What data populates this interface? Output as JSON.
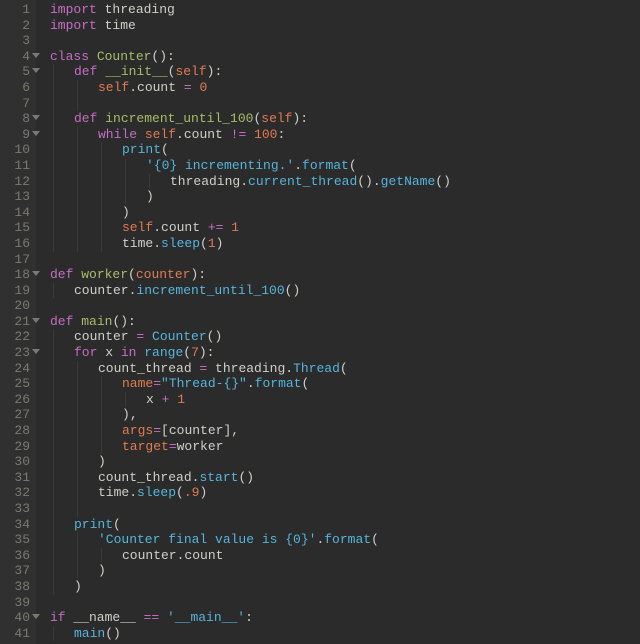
{
  "code": {
    "lines": [
      {
        "n": 1,
        "fold": false,
        "tokens": [
          [
            "kw",
            "import"
          ],
          [
            "name",
            " threading"
          ]
        ]
      },
      {
        "n": 2,
        "fold": false,
        "tokens": [
          [
            "kw",
            "import"
          ],
          [
            "name",
            " time"
          ]
        ]
      },
      {
        "n": 3,
        "fold": false,
        "tokens": []
      },
      {
        "n": 4,
        "fold": true,
        "tokens": [
          [
            "kw",
            "class "
          ],
          [
            "fn",
            "Counter"
          ],
          [
            "paren",
            "():"
          ]
        ]
      },
      {
        "n": 5,
        "fold": true,
        "indent": 1,
        "tokens": [
          [
            "kw",
            "def "
          ],
          [
            "fn",
            "__init__"
          ],
          [
            "paren",
            "("
          ],
          [
            "arg",
            "self"
          ],
          [
            "paren",
            "):"
          ]
        ]
      },
      {
        "n": 6,
        "fold": false,
        "indent": 2,
        "tokens": [
          [
            "arg",
            "self"
          ],
          [
            "name",
            "."
          ],
          [
            "name",
            "count "
          ],
          [
            "op",
            "="
          ],
          [
            "name",
            " "
          ],
          [
            "num",
            "0"
          ]
        ]
      },
      {
        "n": 7,
        "fold": false,
        "indent": 2,
        "tokens": []
      },
      {
        "n": 8,
        "fold": true,
        "indent": 1,
        "tokens": [
          [
            "kw",
            "def "
          ],
          [
            "fn",
            "increment_until_100"
          ],
          [
            "paren",
            "("
          ],
          [
            "arg",
            "self"
          ],
          [
            "paren",
            "):"
          ]
        ]
      },
      {
        "n": 9,
        "fold": true,
        "indent": 2,
        "tokens": [
          [
            "kw",
            "while "
          ],
          [
            "arg",
            "self"
          ],
          [
            "name",
            "."
          ],
          [
            "name",
            "count "
          ],
          [
            "op",
            "!="
          ],
          [
            "name",
            " "
          ],
          [
            "num",
            "100"
          ],
          [
            "paren",
            ":"
          ]
        ]
      },
      {
        "n": 10,
        "fold": false,
        "indent": 3,
        "tokens": [
          [
            "bcall",
            "print"
          ],
          [
            "paren",
            "("
          ]
        ]
      },
      {
        "n": 11,
        "fold": false,
        "indent": 4,
        "tokens": [
          [
            "str",
            "'{0} incrementing.'"
          ],
          [
            "name",
            "."
          ],
          [
            "bcall",
            "format"
          ],
          [
            "paren",
            "("
          ]
        ]
      },
      {
        "n": 12,
        "fold": false,
        "indent": 5,
        "tokens": [
          [
            "name",
            "threading"
          ],
          [
            "name",
            "."
          ],
          [
            "bcall",
            "current_thread"
          ],
          [
            "paren",
            "()"
          ],
          [
            "name",
            "."
          ],
          [
            "bcall",
            "getName"
          ],
          [
            "paren",
            "()"
          ]
        ]
      },
      {
        "n": 13,
        "fold": false,
        "indent": 4,
        "tokens": [
          [
            "paren",
            ")"
          ]
        ]
      },
      {
        "n": 14,
        "fold": false,
        "indent": 3,
        "tokens": [
          [
            "paren",
            ")"
          ]
        ]
      },
      {
        "n": 15,
        "fold": false,
        "indent": 3,
        "tokens": [
          [
            "arg",
            "self"
          ],
          [
            "name",
            "."
          ],
          [
            "name",
            "count "
          ],
          [
            "op",
            "+="
          ],
          [
            "name",
            " "
          ],
          [
            "num",
            "1"
          ]
        ]
      },
      {
        "n": 16,
        "fold": false,
        "indent": 3,
        "tokens": [
          [
            "name",
            "time"
          ],
          [
            "name",
            "."
          ],
          [
            "bcall",
            "sleep"
          ],
          [
            "paren",
            "("
          ],
          [
            "num",
            "1"
          ],
          [
            "paren",
            ")"
          ]
        ]
      },
      {
        "n": 17,
        "fold": false,
        "tokens": []
      },
      {
        "n": 18,
        "fold": true,
        "tokens": [
          [
            "kw",
            "def "
          ],
          [
            "fn",
            "worker"
          ],
          [
            "paren",
            "("
          ],
          [
            "arg",
            "counter"
          ],
          [
            "paren",
            "):"
          ]
        ]
      },
      {
        "n": 19,
        "fold": false,
        "indent": 1,
        "tokens": [
          [
            "name",
            "counter"
          ],
          [
            "name",
            "."
          ],
          [
            "bcall",
            "increment_until_100"
          ],
          [
            "paren",
            "()"
          ]
        ]
      },
      {
        "n": 20,
        "fold": false,
        "tokens": []
      },
      {
        "n": 21,
        "fold": true,
        "tokens": [
          [
            "kw",
            "def "
          ],
          [
            "fn",
            "main"
          ],
          [
            "paren",
            "():"
          ]
        ]
      },
      {
        "n": 22,
        "fold": false,
        "indent": 1,
        "tokens": [
          [
            "name",
            "counter "
          ],
          [
            "op",
            "="
          ],
          [
            "name",
            " "
          ],
          [
            "bcall",
            "Counter"
          ],
          [
            "paren",
            "()"
          ]
        ]
      },
      {
        "n": 23,
        "fold": true,
        "indent": 1,
        "tokens": [
          [
            "kw",
            "for "
          ],
          [
            "name",
            "x "
          ],
          [
            "kw",
            "in "
          ],
          [
            "bcall",
            "range"
          ],
          [
            "paren",
            "("
          ],
          [
            "num",
            "7"
          ],
          [
            "paren",
            "):"
          ]
        ]
      },
      {
        "n": 24,
        "fold": false,
        "indent": 2,
        "tokens": [
          [
            "name",
            "count_thread "
          ],
          [
            "op",
            "="
          ],
          [
            "name",
            " threading"
          ],
          [
            "name",
            "."
          ],
          [
            "bcall",
            "Thread"
          ],
          [
            "paren",
            "("
          ]
        ]
      },
      {
        "n": 25,
        "fold": false,
        "indent": 3,
        "tokens": [
          [
            "arg",
            "name"
          ],
          [
            "op",
            "="
          ],
          [
            "str",
            "\"Thread-{}\""
          ],
          [
            "name",
            "."
          ],
          [
            "bcall",
            "format"
          ],
          [
            "paren",
            "("
          ]
        ]
      },
      {
        "n": 26,
        "fold": false,
        "indent": 4,
        "tokens": [
          [
            "name",
            "x "
          ],
          [
            "op",
            "+"
          ],
          [
            "name",
            " "
          ],
          [
            "num",
            "1"
          ]
        ]
      },
      {
        "n": 27,
        "fold": false,
        "indent": 3,
        "tokens": [
          [
            "paren",
            ")"
          ],
          [
            "name",
            ","
          ]
        ]
      },
      {
        "n": 28,
        "fold": false,
        "indent": 3,
        "tokens": [
          [
            "arg",
            "args"
          ],
          [
            "op",
            "="
          ],
          [
            "paren",
            "["
          ],
          [
            "name",
            "counter"
          ],
          [
            "paren",
            "]"
          ],
          [
            "name",
            ","
          ]
        ]
      },
      {
        "n": 29,
        "fold": false,
        "indent": 3,
        "tokens": [
          [
            "arg",
            "target"
          ],
          [
            "op",
            "="
          ],
          [
            "name",
            "worker"
          ]
        ]
      },
      {
        "n": 30,
        "fold": false,
        "indent": 2,
        "tokens": [
          [
            "paren",
            ")"
          ]
        ]
      },
      {
        "n": 31,
        "fold": false,
        "indent": 2,
        "tokens": [
          [
            "name",
            "count_thread"
          ],
          [
            "name",
            "."
          ],
          [
            "bcall",
            "start"
          ],
          [
            "paren",
            "()"
          ]
        ]
      },
      {
        "n": 32,
        "fold": false,
        "indent": 2,
        "tokens": [
          [
            "name",
            "time"
          ],
          [
            "name",
            "."
          ],
          [
            "bcall",
            "sleep"
          ],
          [
            "paren",
            "("
          ],
          [
            "num",
            ".9"
          ],
          [
            "paren",
            ")"
          ]
        ]
      },
      {
        "n": 33,
        "fold": false,
        "indent": 2,
        "tokens": []
      },
      {
        "n": 34,
        "fold": false,
        "indent": 1,
        "tokens": [
          [
            "bcall",
            "print"
          ],
          [
            "paren",
            "("
          ]
        ]
      },
      {
        "n": 35,
        "fold": false,
        "indent": 2,
        "tokens": [
          [
            "str",
            "'Counter final value is {0}'"
          ],
          [
            "name",
            "."
          ],
          [
            "bcall",
            "format"
          ],
          [
            "paren",
            "("
          ]
        ]
      },
      {
        "n": 36,
        "fold": false,
        "indent": 3,
        "tokens": [
          [
            "name",
            "counter"
          ],
          [
            "name",
            "."
          ],
          [
            "name",
            "count"
          ]
        ]
      },
      {
        "n": 37,
        "fold": false,
        "indent": 2,
        "tokens": [
          [
            "paren",
            ")"
          ]
        ]
      },
      {
        "n": 38,
        "fold": false,
        "indent": 1,
        "tokens": [
          [
            "paren",
            ")"
          ]
        ]
      },
      {
        "n": 39,
        "fold": false,
        "tokens": []
      },
      {
        "n": 40,
        "fold": true,
        "tokens": [
          [
            "kw",
            "if "
          ],
          [
            "name",
            "__name__ "
          ],
          [
            "op",
            "=="
          ],
          [
            "name",
            " "
          ],
          [
            "str",
            "'__main__'"
          ],
          [
            "paren",
            ":"
          ]
        ]
      },
      {
        "n": 41,
        "fold": false,
        "indent": 1,
        "tokens": [
          [
            "bcall",
            "main"
          ],
          [
            "paren",
            "()"
          ]
        ]
      }
    ]
  }
}
